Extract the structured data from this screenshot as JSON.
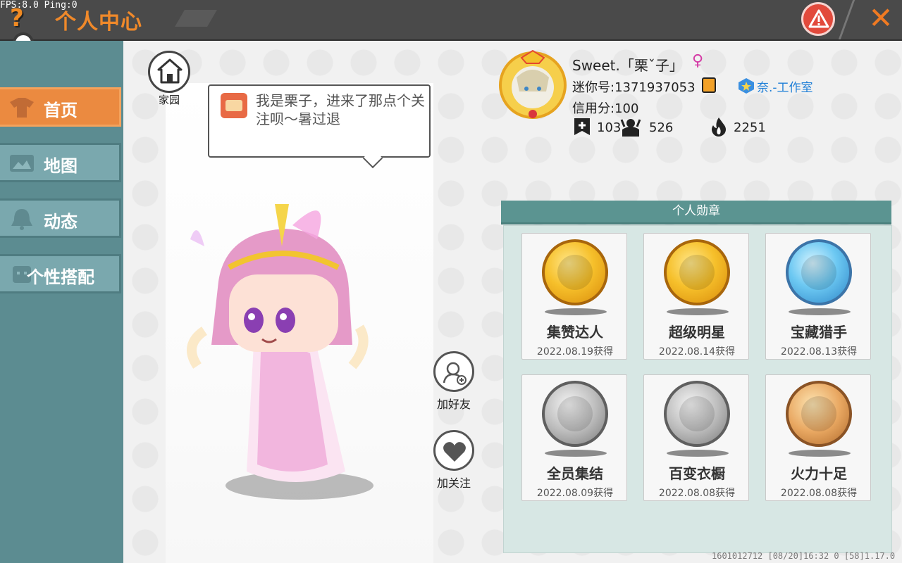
{
  "debug": {
    "fps": "FPS:8.0  Ping:0"
  },
  "header": {
    "help": "?",
    "title": "个人中心",
    "close": "✕"
  },
  "sidebar": {
    "items": [
      {
        "label": "首页",
        "active": true
      },
      {
        "label": "地图",
        "active": false
      },
      {
        "label": "动态",
        "active": false
      },
      {
        "label": "个性搭配",
        "active": false
      }
    ]
  },
  "home": {
    "label": "家园"
  },
  "bubble": {
    "text": "我是栗子，进来了那点个关注呗～暑过退"
  },
  "actions": {
    "add_friend": "加好友",
    "follow": "加关注"
  },
  "profile": {
    "name": "Sweet.「栗ˇ子」",
    "gender_symbol": "♀",
    "mini_id": "迷你号:1371937053",
    "studio": "奈.-工作室",
    "credit": "信用分:100",
    "stats": [
      {
        "icon": "add-icon",
        "value": "103"
      },
      {
        "icon": "fans-icon",
        "value": "526"
      },
      {
        "icon": "fire-icon",
        "value": "2251"
      }
    ]
  },
  "medals": {
    "title": "个人勋章",
    "items": [
      {
        "name": "集赞达人",
        "date": "2022.08.19获得",
        "style": "gold"
      },
      {
        "name": "超级明星",
        "date": "2022.08.14获得",
        "style": "gold"
      },
      {
        "name": "宝藏猎手",
        "date": "2022.08.13获得",
        "style": "blue"
      },
      {
        "name": "全员集结",
        "date": "2022.08.09获得",
        "style": "silver"
      },
      {
        "name": "百变衣橱",
        "date": "2022.08.08获得",
        "style": "silver"
      },
      {
        "name": "火力十足",
        "date": "2022.08.08获得",
        "style": "bronze"
      }
    ]
  },
  "footer": {
    "info": "1601012712   [08/20]16:32 0  [58]1.17.0"
  },
  "colors": {
    "accent": "#eb8a40",
    "sidebar": "#5c8c91",
    "medal_header": "#5b9491",
    "gender": "#d43aa5",
    "studio": "#1f7fd7"
  }
}
